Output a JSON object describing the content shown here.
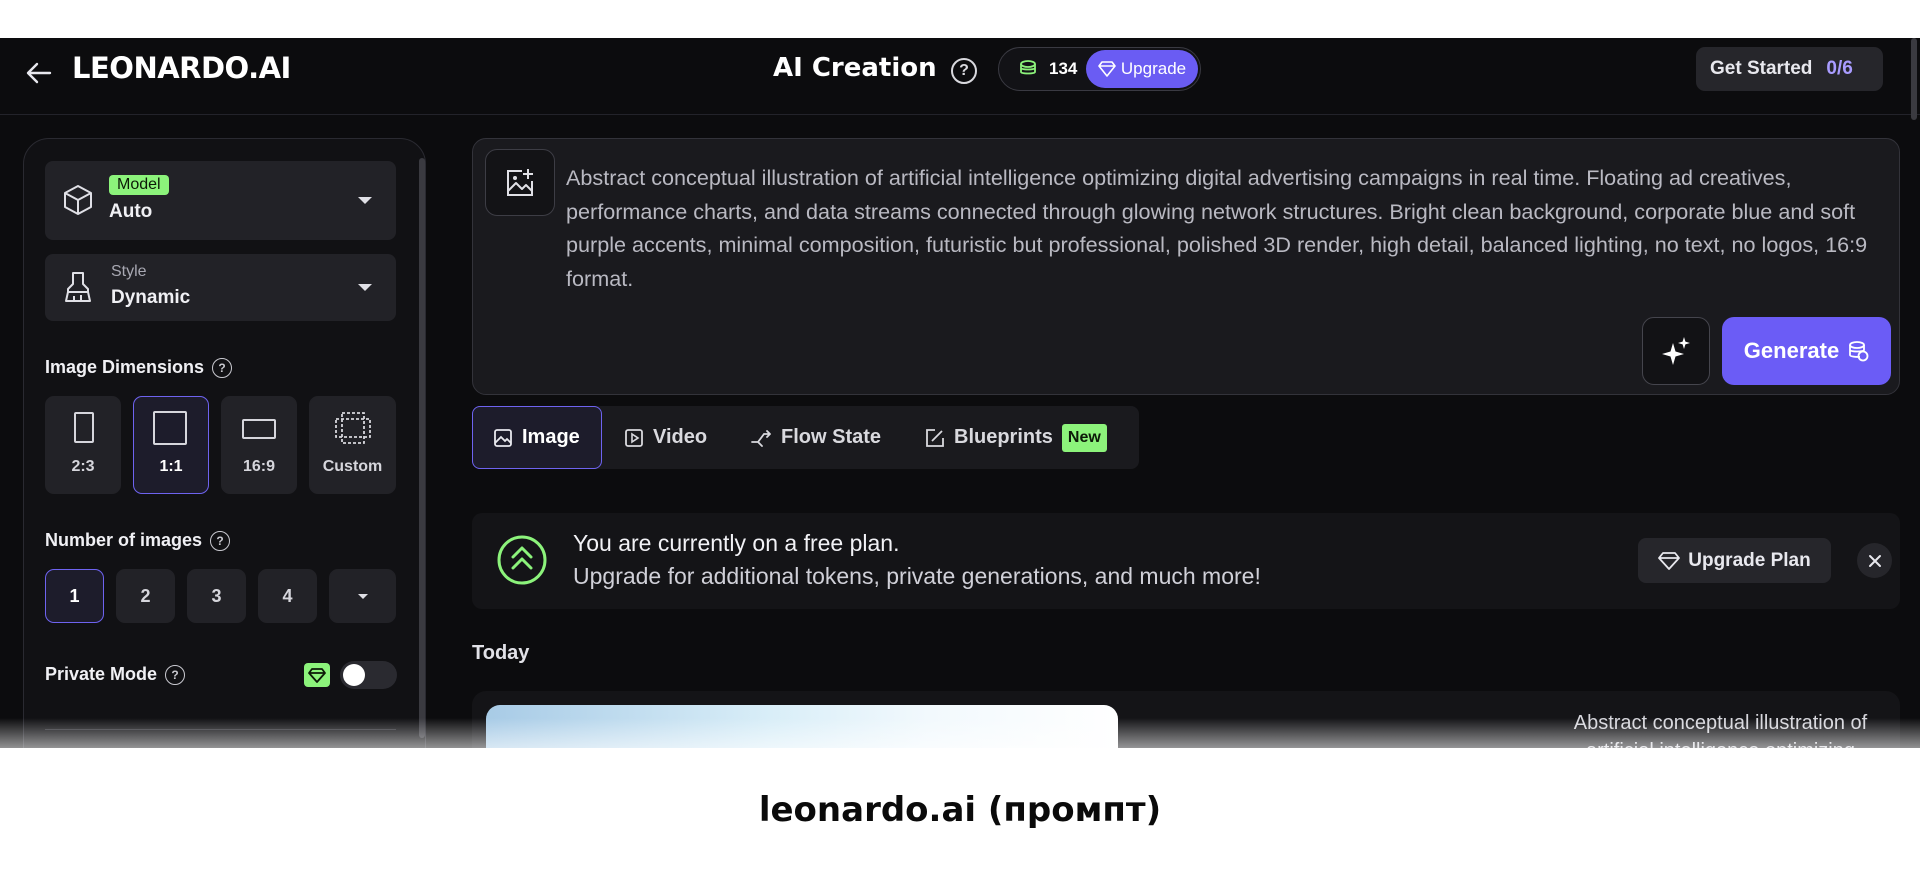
{
  "header": {
    "logo": "LEONARDO.AI",
    "title": "AI Creation",
    "token_count": "134",
    "upgrade_label": "Upgrade",
    "get_started_label": "Get Started",
    "get_started_progress": "0/6"
  },
  "sidebar": {
    "model": {
      "tag": "Model",
      "value": "Auto"
    },
    "style": {
      "label": "Style",
      "value": "Dynamic"
    },
    "image_dimensions": {
      "label": "Image Dimensions",
      "options": [
        "2:3",
        "1:1",
        "16:9",
        "Custom"
      ],
      "selected": "1:1"
    },
    "number_of_images": {
      "label": "Number of images",
      "options": [
        "1",
        "2",
        "3",
        "4"
      ],
      "selected": "1"
    },
    "private_mode": {
      "label": "Private Mode",
      "enabled": false
    }
  },
  "prompt": {
    "text": "Abstract conceptual illustration of artificial intelligence optimizing digital advertising campaigns in real time. Floating ad creatives, performance charts, and data streams connected through glowing network structures. Bright clean background, corporate blue and soft purple accents, minimal composition, futuristic but professional, polished 3D render, high detail, balanced lighting, no text, no logos, 16:9 format.",
    "generate_label": "Generate"
  },
  "tabs": {
    "image": "Image",
    "video": "Video",
    "flow_state": "Flow State",
    "blueprints": "Blueprints",
    "new_badge": "New",
    "selected": "Image"
  },
  "banner": {
    "title": "You are currently on a free plan.",
    "subtitle": "Upgrade for additional tokens, private generations, and much more!",
    "upgrade_plan_label": "Upgrade Plan"
  },
  "feed": {
    "section_label": "Today",
    "generation_prompt": "Abstract conceptual illustration of artificial intelligence optimizing"
  },
  "caption": "leonardo.ai (промпт)",
  "colors": {
    "accent": "#6b5cf6",
    "new_badge": "#8cf37b",
    "background": "#0c0c0e"
  }
}
